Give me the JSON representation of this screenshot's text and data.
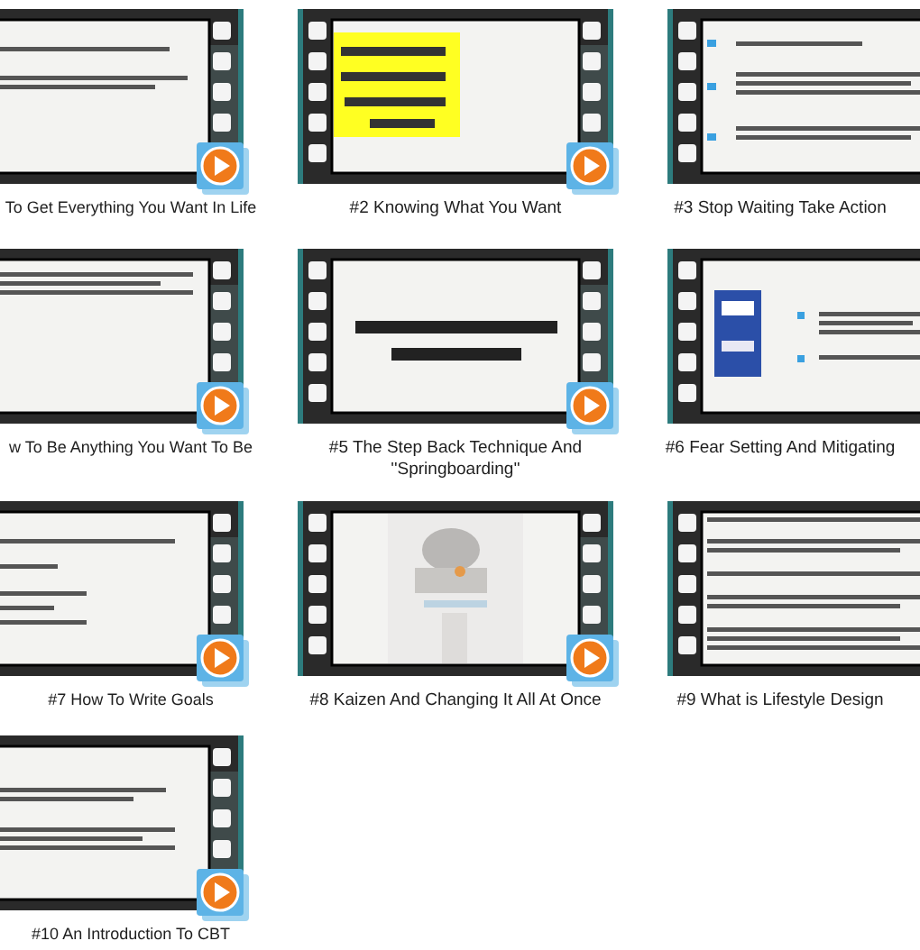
{
  "videos": [
    {
      "title": "To Get Everything You Want In Life"
    },
    {
      "title": "#2 Knowing What You Want"
    },
    {
      "title": "#3 Stop Waiting Take Action"
    },
    {
      "title": "w To Be Anything You Want To Be"
    },
    {
      "title": "#5 The Step Back Technique And ''Springboarding''"
    },
    {
      "title": "#6 Fear Setting And Mitigating"
    },
    {
      "title": "#7 How To Write Goals"
    },
    {
      "title": "#8 Kaizen And Changing It All At Once"
    },
    {
      "title": "#9 What is Lifestyle Design"
    },
    {
      "title": "#10 An Introduction To CBT"
    }
  ]
}
